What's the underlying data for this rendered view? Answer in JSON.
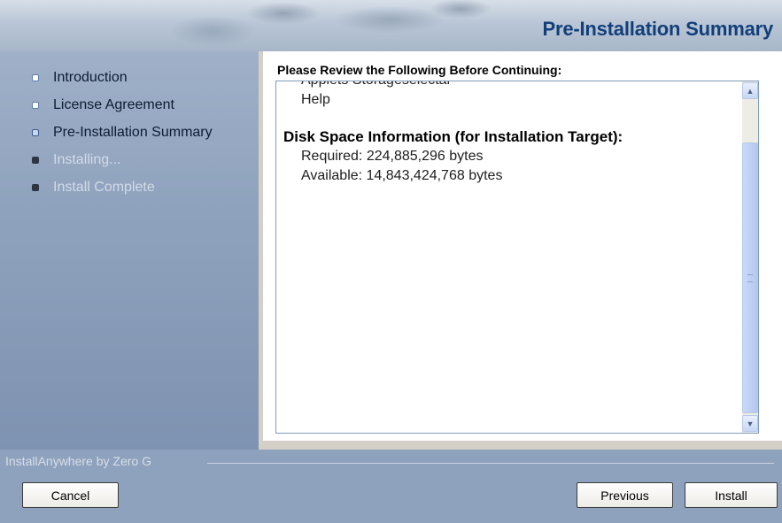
{
  "window": {
    "title": "Pre-Installation Summary"
  },
  "sidebar": {
    "steps": [
      {
        "label": "Introduction",
        "state": "done"
      },
      {
        "label": "License Agreement",
        "state": "done"
      },
      {
        "label": "Pre-Installation Summary",
        "state": "current"
      },
      {
        "label": "Installing...",
        "state": "todo"
      },
      {
        "label": "Install Complete",
        "state": "todo"
      }
    ]
  },
  "main": {
    "heading": "Please Review the Following Before Continuing:",
    "lines": {
      "partial": "Applets Storageselectal",
      "help": "Help",
      "disk_heading": "Disk Space Information (for Installation Target):",
      "required": "Required: 224,885,296 bytes",
      "available": "Available: 14,843,424,768 bytes"
    }
  },
  "footer": {
    "brand": "InstallAnywhere by Zero G",
    "cancel_label": "Cancel",
    "previous_label": "Previous",
    "install_label": "Install"
  },
  "colors": {
    "title": "#123f7a",
    "sidebar": "#8fa2bd",
    "scroll_border": "#7f9db9"
  }
}
